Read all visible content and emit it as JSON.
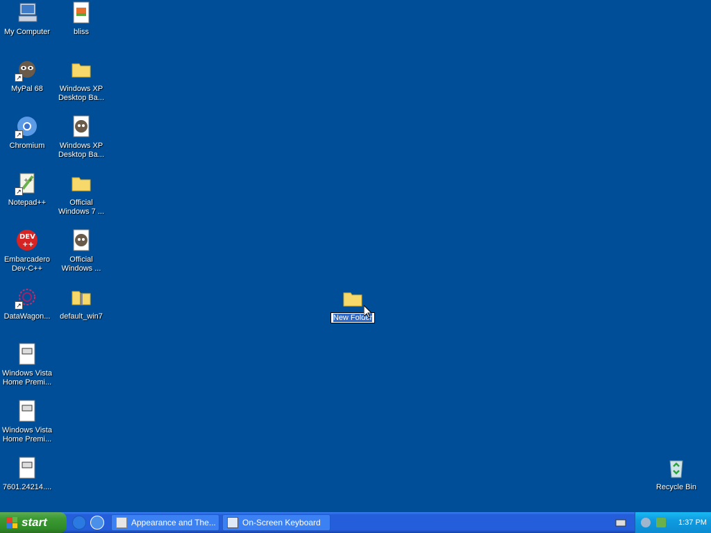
{
  "desktop": {
    "background_color": "#004e98",
    "icons": {
      "my_computer": "My Computer",
      "bliss": "bliss",
      "mypal": "MyPal 68",
      "winxp_bg1": "Windows XP\nDesktop Ba...",
      "chromium": "Chromium",
      "winxp_bg2": "Windows XP\nDesktop Ba...",
      "notepadpp": "Notepad++",
      "official_win7": "Official\nWindows 7 ...",
      "devcpp": "Embarcadero\nDev-C++",
      "official_windows": "Official\nWindows ...",
      "datawagon": "DataWagon...",
      "default_win7": "default_win7",
      "vista1": "Windows Vista\nHome Premi...",
      "vista2": "Windows Vista\nHome Premi...",
      "file7601": "7601.24214....",
      "recycle_bin": "Recycle Bin"
    },
    "new_folder": {
      "name_selected": "New Folder"
    }
  },
  "taskbar": {
    "start_label": "start",
    "tasks": [
      {
        "label": "Appearance and The..."
      },
      {
        "label": "On-Screen Keyboard"
      }
    ],
    "clock": "1:37 PM",
    "icons": [
      "ie-icon",
      "mypal-quicklaunch-icon",
      "keyboard-tray-icon",
      "volume-icon",
      "network-icon"
    ]
  }
}
